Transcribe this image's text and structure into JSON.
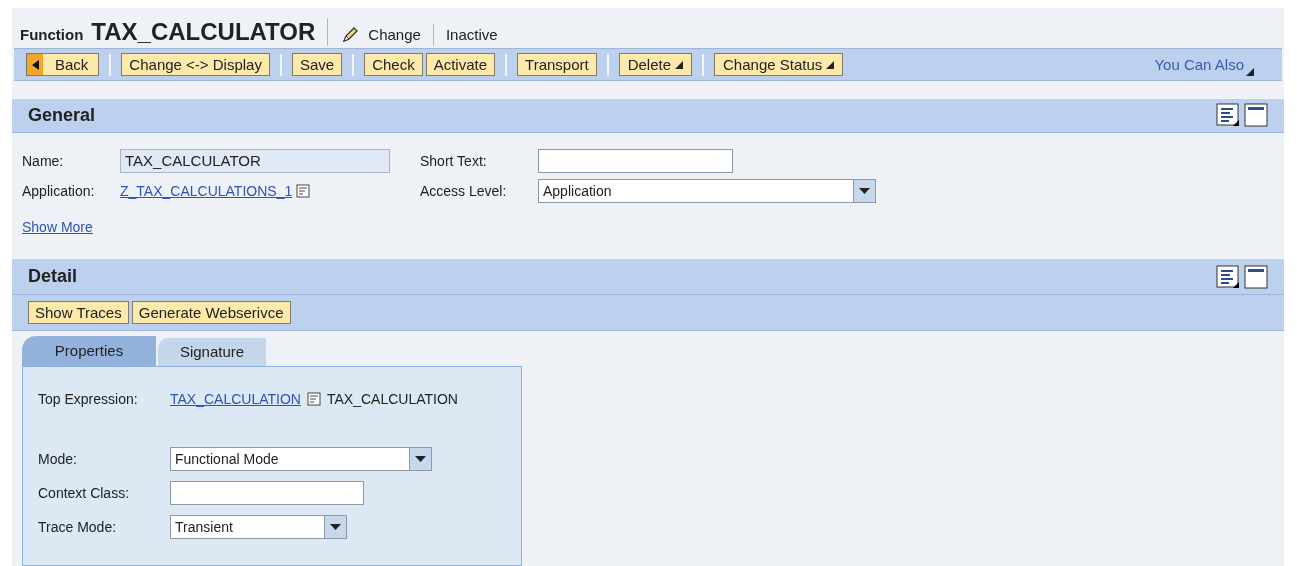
{
  "header": {
    "object_type": "Function",
    "object_name": "TAX_CALCULATOR",
    "mode": "Change",
    "status": "Inactive"
  },
  "toolbar": {
    "groups": [
      [
        {
          "label": "Back",
          "kind": "back"
        }
      ],
      [
        {
          "label": "Change <-> Display",
          "kind": "plain"
        }
      ],
      [
        {
          "label": "Save",
          "kind": "plain"
        }
      ],
      [
        {
          "label": "Check",
          "kind": "plain"
        },
        {
          "label": "Activate",
          "kind": "plain"
        }
      ],
      [
        {
          "label": "Transport",
          "kind": "plain"
        }
      ],
      [
        {
          "label": "Delete",
          "kind": "menu"
        }
      ],
      [
        {
          "label": "Change Status",
          "kind": "menu"
        }
      ]
    ],
    "more_menu": "You Can Also"
  },
  "general": {
    "title": "General",
    "name": {
      "label": "Name:",
      "value": "TAX_CALCULATOR"
    },
    "application": {
      "label": "Application:",
      "link": "Z_TAX_CALCULATIONS_1"
    },
    "short_text": {
      "label": "Short Text:"
    },
    "access_level": {
      "label": "Access Level:",
      "value": "Application"
    },
    "show_more": "Show More"
  },
  "detail": {
    "title": "Detail",
    "buttons": [
      "Show Traces",
      "Generate Webserivce"
    ],
    "tabs": [
      {
        "label": "Properties",
        "selected": true
      },
      {
        "label": "Signature",
        "selected": false
      }
    ],
    "properties": {
      "top_expression": {
        "label": "Top Expression:",
        "link": "TAX_CALCULATION",
        "text": "TAX_CALCULATION"
      },
      "mode": {
        "label": "Mode:",
        "value": "Functional Mode"
      },
      "context_class": {
        "label": "Context Class:"
      },
      "trace_mode": {
        "label": "Trace Mode:",
        "value": "Transient"
      }
    }
  }
}
